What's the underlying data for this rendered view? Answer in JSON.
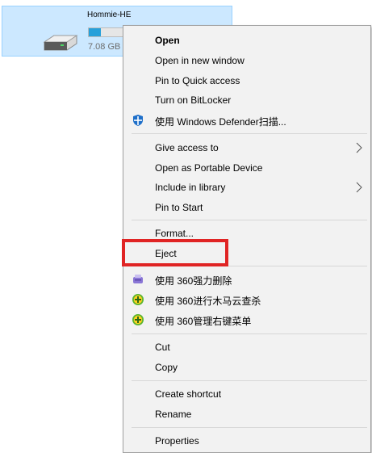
{
  "drive": {
    "name": "Hommie-HE",
    "size_text": "7.08 GB",
    "usage_fraction": 0.3
  },
  "menu": {
    "open": "Open",
    "open_new_window": "Open in new window",
    "pin_quick_access": "Pin to Quick access",
    "turn_on_bitlocker": "Turn on BitLocker",
    "defender_scan": "使用 Windows Defender扫描...",
    "give_access": "Give access to",
    "open_portable": "Open as Portable Device",
    "include_library": "Include in library",
    "pin_start": "Pin to Start",
    "format": "Format...",
    "eject": "Eject",
    "force_delete_360": "使用 360强力删除",
    "trojan_scan_360": "使用 360进行木马云查杀",
    "manage_menu_360": "使用 360管理右键菜单",
    "cut": "Cut",
    "copy": "Copy",
    "create_shortcut": "Create shortcut",
    "rename": "Rename",
    "properties": "Properties"
  },
  "colors": {
    "selection_bg": "#cce8ff",
    "highlight_box": "#e02424",
    "menu_bg": "#f2f2f2"
  }
}
